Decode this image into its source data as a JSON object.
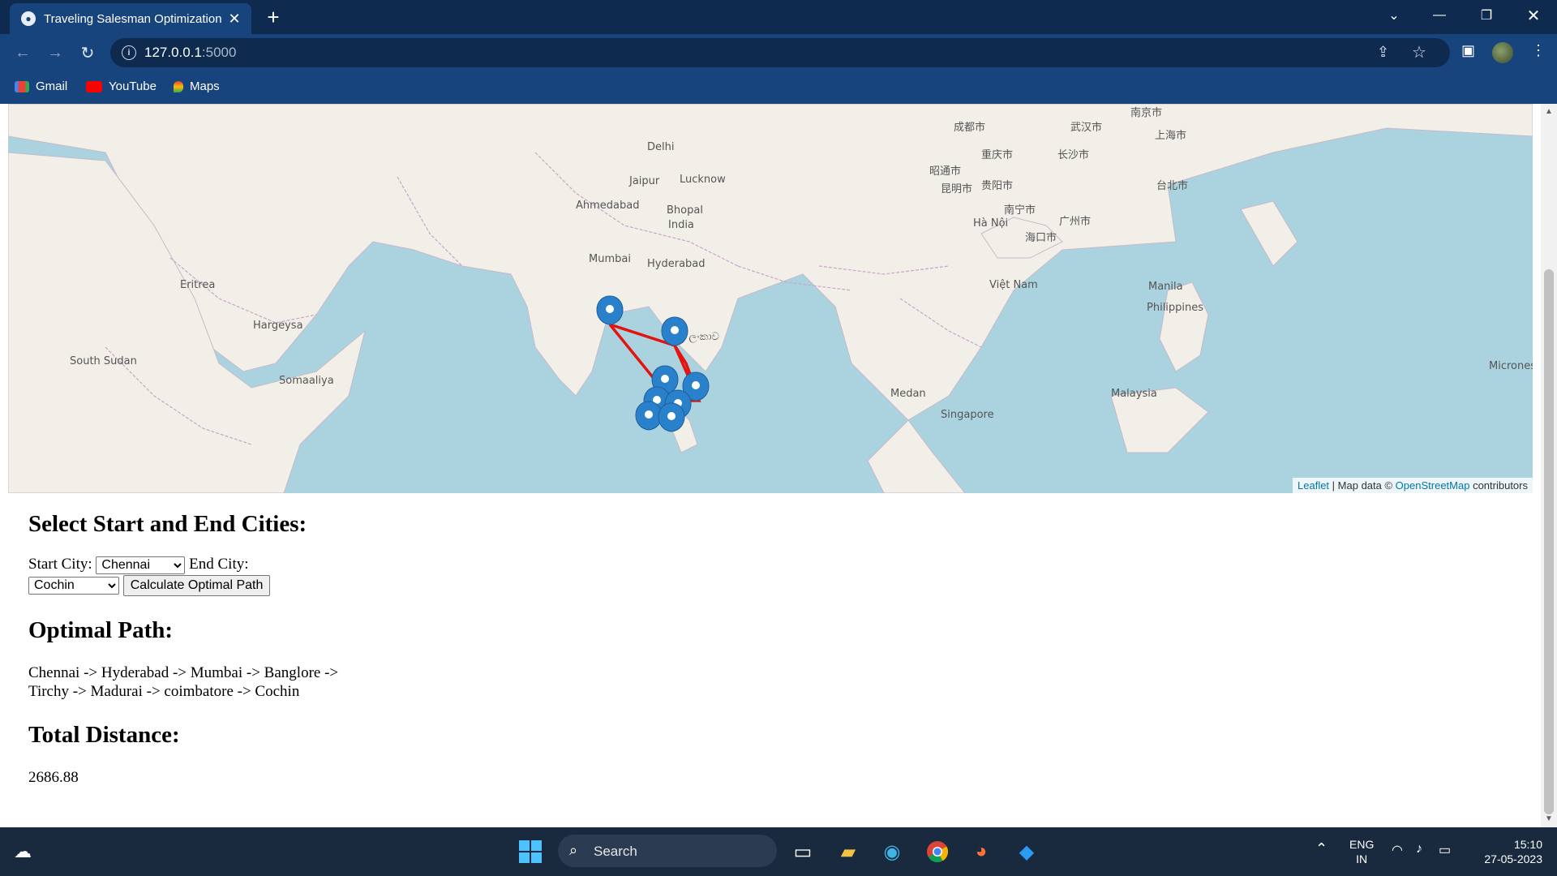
{
  "browser": {
    "tab_title": "Traveling Salesman Optimization",
    "url_host": "127.0.0.1",
    "url_port": ":5000",
    "bookmarks": [
      "Gmail",
      "YouTube",
      "Maps"
    ]
  },
  "map": {
    "attribution": {
      "leaflet": "Leaflet",
      "text1": " | Map data © ",
      "osm": "OpenStreetMap",
      "text2": " contributors"
    },
    "labels": [
      "Delhi",
      "Jaipur",
      "Lucknow",
      "Ahmedabad",
      "Bhopal",
      "India",
      "Mumbai",
      "Hyderabad",
      "Hargeysa",
      "South Sudan",
      "Somaaliya",
      "Medan",
      "Singapore",
      "Manila",
      "Philippines",
      "Malaysia",
      "Việt Nam",
      "Hà Nội",
      "海口市",
      "广州市",
      "南宁市",
      "成都市",
      "重庆市",
      "武汉市",
      "长沙市",
      "上海市",
      "南京市",
      "台北市",
      "Micrones",
      "昆明市",
      "贵阳市",
      "昭通市",
      "Eritrea",
      "ශ්‍රී ලංකාව"
    ],
    "route_color": "#e3140f",
    "marker_color": "#2a81cb"
  },
  "form": {
    "heading": "Select Start and End Cities:",
    "start_label": "Start City:",
    "start_value": "Chennai",
    "end_label": "End City:",
    "end_value": "Cochin",
    "button": "Calculate Optimal Path"
  },
  "result": {
    "path_heading": "Optimal Path:",
    "path_text": "Chennai -> Hyderabad -> Mumbai -> Banglore -> Tirchy -> Madurai -> coimbatore -> Cochin",
    "distance_heading": "Total Distance:",
    "distance_value": "2686.88"
  },
  "taskbar": {
    "search_placeholder": "Search",
    "lang_line1": "ENG",
    "lang_line2": "IN",
    "time": "15:10",
    "date": "27-05-2023"
  }
}
